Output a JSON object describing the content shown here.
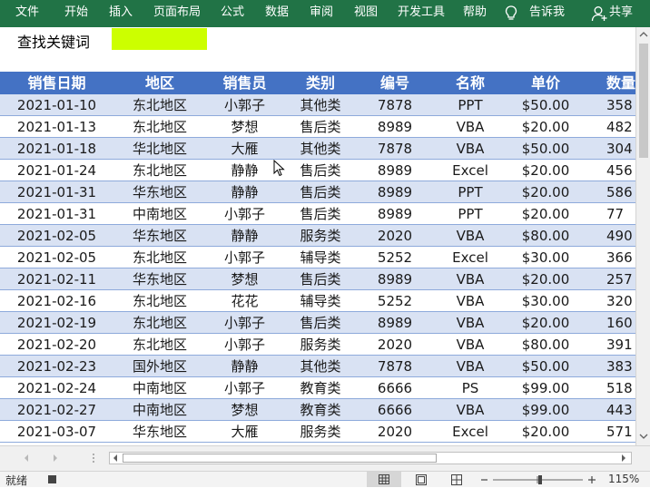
{
  "ribbon": {
    "tabs": [
      "文件",
      "开始",
      "插入",
      "页面布局",
      "公式",
      "数据",
      "审阅",
      "视图",
      "开发工具",
      "帮助"
    ],
    "tell_me": "告诉我",
    "share": "共享"
  },
  "search": {
    "label": "查找关键词",
    "highlight_color": "#ccff00"
  },
  "table": {
    "headers": [
      "销售日期",
      "地区",
      "销售员",
      "类别",
      "编号",
      "名称",
      "单价",
      "数量"
    ],
    "rows": [
      [
        "2021-01-10",
        "东北地区",
        "小郭子",
        "其他类",
        "7878",
        "PPT",
        "$50.00",
        "358"
      ],
      [
        "2021-01-13",
        "东北地区",
        "梦想",
        "售后类",
        "8989",
        "VBA",
        "$20.00",
        "482"
      ],
      [
        "2021-01-18",
        "华北地区",
        "大雁",
        "其他类",
        "7878",
        "VBA",
        "$50.00",
        "304"
      ],
      [
        "2021-01-24",
        "东北地区",
        "静静",
        "售后类",
        "8989",
        "Excel",
        "$20.00",
        "456"
      ],
      [
        "2021-01-31",
        "华东地区",
        "静静",
        "售后类",
        "8989",
        "PPT",
        "$20.00",
        "586"
      ],
      [
        "2021-01-31",
        "中南地区",
        "小郭子",
        "售后类",
        "8989",
        "PPT",
        "$20.00",
        "77"
      ],
      [
        "2021-02-05",
        "华东地区",
        "静静",
        "服务类",
        "2020",
        "VBA",
        "$80.00",
        "490"
      ],
      [
        "2021-02-05",
        "东北地区",
        "小郭子",
        "辅导类",
        "5252",
        "Excel",
        "$30.00",
        "366"
      ],
      [
        "2021-02-11",
        "华东地区",
        "梦想",
        "售后类",
        "8989",
        "VBA",
        "$20.00",
        "257"
      ],
      [
        "2021-02-16",
        "东北地区",
        "花花",
        "辅导类",
        "5252",
        "VBA",
        "$30.00",
        "320"
      ],
      [
        "2021-02-19",
        "东北地区",
        "小郭子",
        "售后类",
        "8989",
        "VBA",
        "$20.00",
        "160"
      ],
      [
        "2021-02-20",
        "东北地区",
        "小郭子",
        "服务类",
        "2020",
        "VBA",
        "$80.00",
        "391"
      ],
      [
        "2021-02-23",
        "国外地区",
        "静静",
        "其他类",
        "7878",
        "VBA",
        "$50.00",
        "383"
      ],
      [
        "2021-02-24",
        "中南地区",
        "小郭子",
        "教育类",
        "6666",
        "PS",
        "$99.00",
        "518"
      ],
      [
        "2021-02-27",
        "中南地区",
        "梦想",
        "教育类",
        "6666",
        "VBA",
        "$99.00",
        "443"
      ],
      [
        "2021-03-07",
        "华东地区",
        "大雁",
        "服务类",
        "2020",
        "Excel",
        "$20.00",
        "571"
      ]
    ]
  },
  "status": {
    "ready": "就绪",
    "zoom": "115%"
  },
  "colors": {
    "ribbon": "#217346",
    "header": "#4472c4",
    "band": "#d9e2f3"
  }
}
